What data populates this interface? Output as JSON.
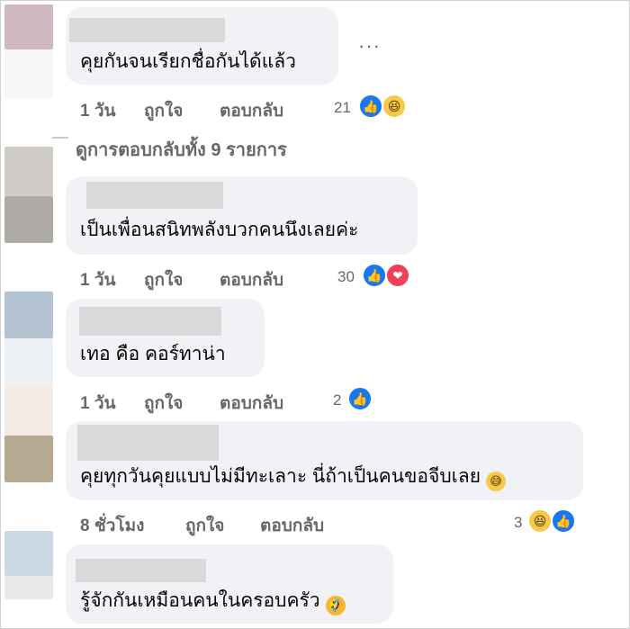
{
  "comments": [
    {
      "text": "คุยกันจนเรียกชื่อกันได้แล้ว",
      "time": "1 วัน",
      "like_label": "ถูกใจ",
      "reply_label": "ตอบกลับ",
      "reaction_count": "21",
      "reactions": [
        "like-icon",
        "haha-icon"
      ]
    },
    {
      "text": "เป็นเพื่อนสนิทพลังบวกคนนึงเลยค่ะ",
      "time": "1 วัน",
      "like_label": "ถูกใจ",
      "reply_label": "ตอบกลับ",
      "reaction_count": "30",
      "reactions": [
        "like-icon",
        "love-icon"
      ]
    },
    {
      "text": "เทอ คือ คอร์ทาน่า",
      "time": "1 วัน",
      "like_label": "ถูกใจ",
      "reply_label": "ตอบกลับ",
      "reaction_count": "2",
      "reactions": [
        "like-icon"
      ]
    },
    {
      "text": "คุยทุกวันคุยแบบไม่มีทะเลาะ นี่ถ้าเป็นคนขอจีบเลย",
      "emoji": "sweat-smile-emoji",
      "time": "8 ชั่วโมง",
      "like_label": "ถูกใจ",
      "reply_label": "ตอบกลับ",
      "reaction_count": "3",
      "reactions": [
        "haha-icon",
        "like-icon"
      ]
    },
    {
      "text": "รู้จักกันเหมือนคนในครอบครัว",
      "emoji": "rofl-emoji"
    }
  ],
  "view_replies": "ดูการตอบกลับทั้ง 9 รายการ",
  "more_options": "···",
  "colors": {
    "bubble": "#f0f2f5",
    "meta_text": "#65676b",
    "like": "#1877f2",
    "haha": "#f7c948",
    "love": "#f33e58"
  }
}
